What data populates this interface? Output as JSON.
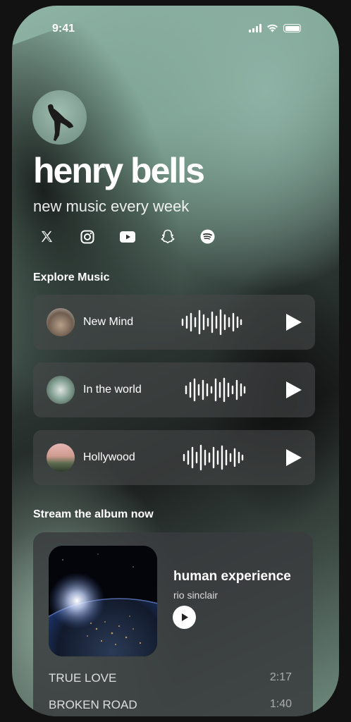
{
  "status_bar": {
    "time": "9:41"
  },
  "profile": {
    "name": "henry bells",
    "tagline": "new music every week",
    "socials": [
      "x-icon",
      "instagram-icon",
      "youtube-icon",
      "snapchat-icon",
      "spotify-icon"
    ]
  },
  "explore": {
    "title": "Explore Music",
    "tracks": [
      {
        "title": "New Mind"
      },
      {
        "title": "In the world"
      },
      {
        "title": "Hollywood"
      }
    ]
  },
  "album_section": {
    "title": "Stream the album now",
    "album_title": "human experience",
    "artist": "rio sinclair",
    "songs": [
      {
        "title": "TRUE LOVE",
        "duration": "2:17"
      },
      {
        "title": "BROKEN ROAD",
        "duration": "1:40"
      }
    ]
  },
  "colors": {
    "accent": "#ffffff",
    "card_bg": "#464848"
  }
}
